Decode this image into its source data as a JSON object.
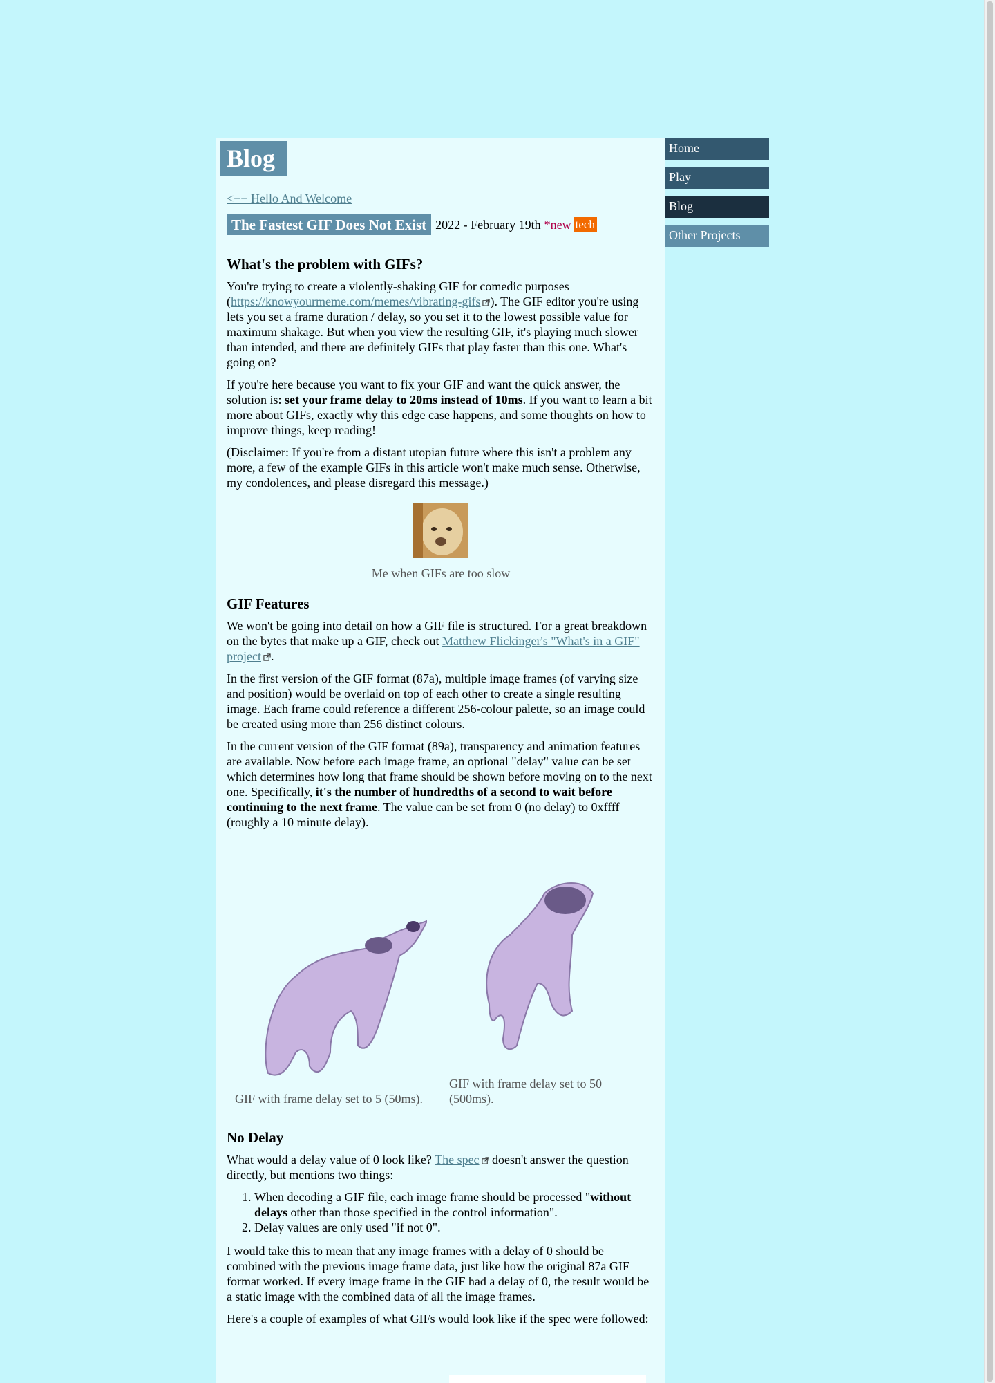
{
  "nav": {
    "items": [
      "Home",
      "Play",
      "Blog",
      "Other Projects"
    ]
  },
  "page": {
    "title": "Blog"
  },
  "post": {
    "back_link": "<−− Hello And Welcome",
    "title": "The Fastest GIF Does Not Exist",
    "date": "2022 - February 19th",
    "new_label": "*new",
    "tag": "tech"
  },
  "section1": {
    "heading": "What's the problem with GIFs?",
    "p1_a": "You're trying to create a violently-shaking GIF for comedic purposes (",
    "p1_link": "https://knowyourmeme.com/memes/vibrating-gifs",
    "p1_b": "). The GIF editor you're using lets you set a frame duration / delay, so you set it to the lowest possible value for maximum shakage. But when you view the resulting GIF, it's playing much slower than intended, and there are definitely GIFs that play faster than this one. What's going on?",
    "p2_a": "If you're here because you want to fix your GIF and want the quick answer, the solution is: ",
    "p2_bold": "set your frame delay to 20ms instead of 10ms",
    "p2_b": ". If you want to learn a bit more about GIFs, exactly why this edge case happens, and some thoughts on how to improve things, keep reading!",
    "p3": "(Disclaimer: If you're from a distant utopian future where this isn't a problem any more, a few of the example GIFs in this article won't make much sense. Otherwise, my condolences, and please disregard this message.)",
    "figure_caption": "Me when GIFs are too slow"
  },
  "section2": {
    "heading": "GIF Features",
    "p1_a": "We won't be going into detail on how a GIF file is structured. For a great breakdown on the bytes that make up a GIF, check out ",
    "p1_link": "Matthew Flickinger's \"What's in a GIF\" project",
    "p1_b": ".",
    "p2": "In the first version of the GIF format (87a), multiple image frames (of varying size and position) would be overlaid on top of each other to create a single resulting image. Each frame could reference a different 256-colour palette, so an image could be created using more than 256 distinct colours.",
    "p3_a": "In the current version of the GIF format (89a), transparency and animation features are available. Now before each image frame, an optional \"delay\" value can be set which determines how long that frame should be shown before moving on to the next one. Specifically, ",
    "p3_bold": "it's the number of hundredths of a second to wait before continuing to the next frame",
    "p3_b": ". The value can be set from 0 (no delay) to 0xffff (roughly a 10 minute delay).",
    "caption1": "GIF with frame delay set to 5 (50ms).",
    "caption2": "GIF with frame delay set to 50 (500ms)."
  },
  "section3": {
    "heading": "No Delay",
    "p1_a": "What would a delay value of 0 look like? ",
    "p1_link": "The spec",
    "p1_b": " doesn't answer the question directly, but mentions two things:",
    "li1_a": "When decoding a GIF file, each image frame should be processed \"",
    "li1_bold": "without delays",
    "li1_b": " other than those specified in the control information\".",
    "li2": "Delay values are only used \"if not 0\".",
    "p2": "I would take this to mean that any image frames with a delay of 0 should be combined with the previous image frame data, just like how the original 87a GIF format worked. If every image frame in the GIF had a delay of 0, the result would be a static image with the combined data of all the image frames.",
    "p3": "Here's a couple of examples of what GIFs would look like if the spec were followed:"
  },
  "colors": {
    "background": "#c4f6fc",
    "content_bg": "#e7fcfe",
    "title_bg": "#5f8fa8",
    "nav_dark": "#33586f",
    "nav_active": "#1b2f3f",
    "tag_orange": "#f26a00",
    "new_red": "#b0004a"
  }
}
